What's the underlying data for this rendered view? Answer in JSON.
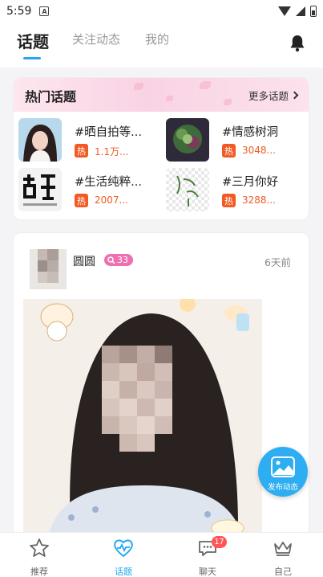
{
  "status_bar": {
    "time": "5:59",
    "notif_letter": "A"
  },
  "header": {
    "tabs": [
      {
        "label": "话题"
      },
      {
        "label": "关注动态"
      },
      {
        "label": "我的"
      }
    ]
  },
  "hot_topics": {
    "title": "热门话题",
    "more_label": "更多话题",
    "hot_label": "热",
    "items": [
      {
        "name": "#晒自拍等...",
        "count": "1.1万..."
      },
      {
        "name": "#情感树洞",
        "count": "3048..."
      },
      {
        "name": "#生活纯粹...",
        "count": "2007..."
      },
      {
        "name": "#三月你好",
        "count": "3288..."
      }
    ]
  },
  "post": {
    "username": "圆圆",
    "level": "33",
    "time": "6天前"
  },
  "fab": {
    "label": "发布动态"
  },
  "bottom_nav": {
    "items": [
      {
        "label": "推荐"
      },
      {
        "label": "话题"
      },
      {
        "label": "聊天",
        "badge": "17"
      },
      {
        "label": "自己"
      }
    ]
  },
  "colors": {
    "accent": "#22a8f0",
    "hot": "#f15a24",
    "level_badge": "#ef6fb0",
    "fab": "#2eaef2"
  }
}
